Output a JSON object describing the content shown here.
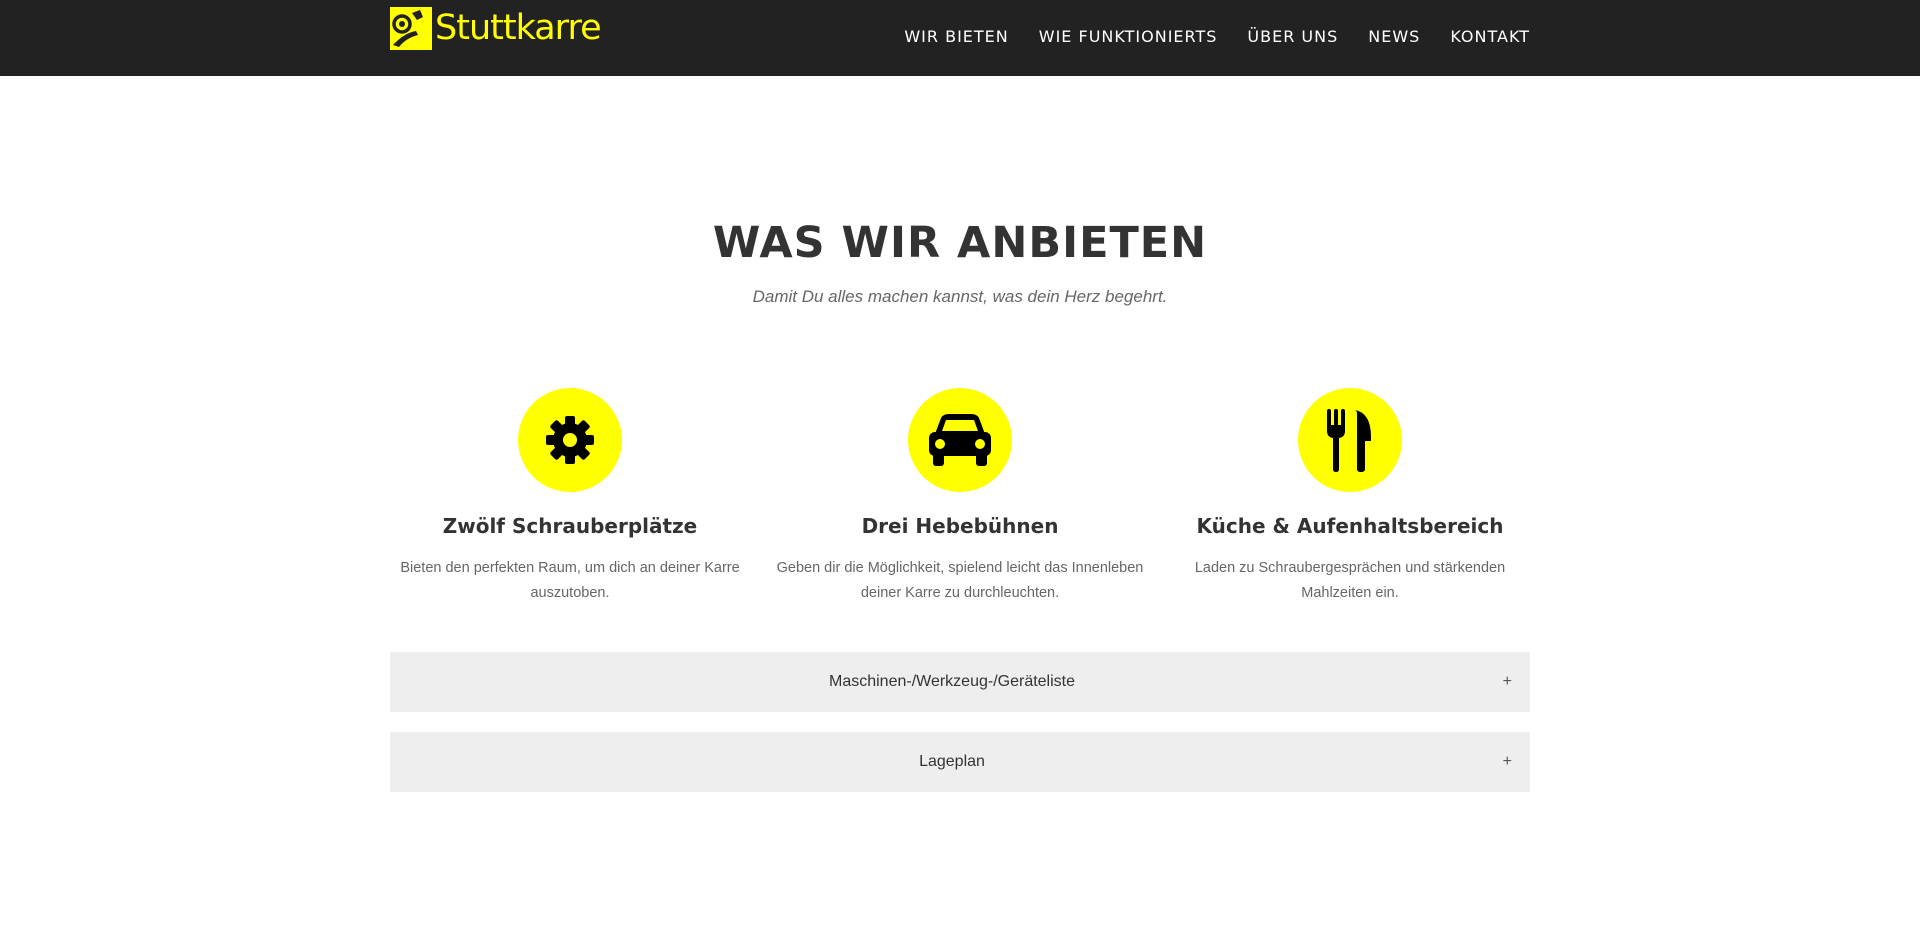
{
  "brand": {
    "name": "Stuttkarre",
    "accent_color": "#ffff00",
    "header_bg": "#222222"
  },
  "nav": {
    "items": [
      {
        "label": "WIR BIETEN"
      },
      {
        "label": "WIE FUNKTIONIERTS"
      },
      {
        "label": "ÜBER UNS"
      },
      {
        "label": "NEWS"
      },
      {
        "label": "KONTAKT"
      }
    ]
  },
  "section": {
    "title": "WAS WIR ANBIETEN",
    "subtitle": "Damit Du alles machen kannst, was dein Herz begehrt."
  },
  "features": [
    {
      "icon": "gear-icon",
      "title": "Zwölf Schrauberplätze",
      "text": "Bieten den perfekten Raum, um dich an deiner Karre auszutoben."
    },
    {
      "icon": "car-icon",
      "title": "Drei Hebebühnen",
      "text": "Geben dir die Möglichkeit, spielend leicht das Innenleben deiner Karre zu durchleuchten."
    },
    {
      "icon": "cutlery-icon",
      "title": "Küche & Aufenhaltsbereich",
      "text": "Laden zu Schraubergesprächen und stärkenden Mahlzeiten ein."
    }
  ],
  "accordions": [
    {
      "label": "Maschinen-/Werkzeug-/Geräteliste",
      "toggle": "+"
    },
    {
      "label": "Lageplan",
      "toggle": "+"
    }
  ]
}
